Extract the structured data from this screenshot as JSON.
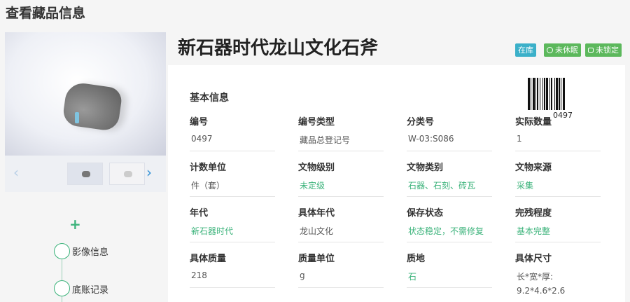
{
  "page_title": "查看藏品信息",
  "object_title": "新石器时代龙山文化石斧",
  "badges": {
    "instock": "在库",
    "sleep": "未休眠",
    "lock": "未锁定"
  },
  "colors": {
    "accent_green": "#3cb37b",
    "badge_cyan": "#3bb0c9",
    "badge_green": "#5cb85c",
    "link_blue": "#2d8fd6"
  },
  "barcode": {
    "number": "0497"
  },
  "section_title": "基本信息",
  "timeline": {
    "add_icon": "plus-icon",
    "items": [
      {
        "label": "影像信息"
      },
      {
        "label": "底账记录"
      }
    ]
  },
  "fields": [
    {
      "label": "编号",
      "value": "0497",
      "green": false
    },
    {
      "label": "编号类型",
      "value": "藏品总登记号",
      "green": false
    },
    {
      "label": "分类号",
      "value": "W-03:S086",
      "green": false
    },
    {
      "label": "实际数量",
      "value": "1",
      "green": false
    },
    {
      "label": "计数单位",
      "value": "件（套）",
      "green": false
    },
    {
      "label": "文物级别",
      "value": "未定级",
      "green": true
    },
    {
      "label": "文物类别",
      "value": "石器、石刻、砖瓦",
      "green": true
    },
    {
      "label": "文物来源",
      "value": "采集",
      "green": true
    },
    {
      "label": "年代",
      "value": "新石器时代",
      "green": true
    },
    {
      "label": "具体年代",
      "value": "龙山文化",
      "green": false
    },
    {
      "label": "保存状态",
      "value": "状态稳定，不需修复",
      "green": true
    },
    {
      "label": "完残程度",
      "value": "基本完整",
      "green": true
    },
    {
      "label": "具体质量",
      "value": "218",
      "green": false
    },
    {
      "label": "质量单位",
      "value": "g",
      "green": false
    },
    {
      "label": "质地",
      "value": "石",
      "green": true
    },
    {
      "label": "具体尺寸",
      "value": "长*宽*厚:",
      "value2": "9.2*4.6*2.6",
      "green": false
    }
  ]
}
